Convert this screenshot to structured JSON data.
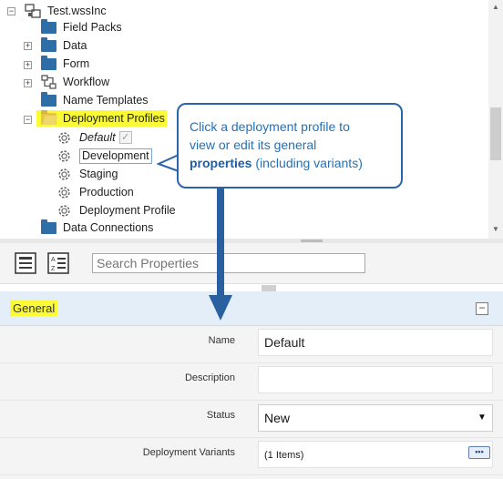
{
  "tree": {
    "root_label": "Test.wssInc",
    "items": [
      {
        "label": "Field Packs",
        "expander": ""
      },
      {
        "label": "Data",
        "expander": "+"
      },
      {
        "label": "Form",
        "expander": "+"
      },
      {
        "label": "Workflow",
        "expander": "+"
      },
      {
        "label": "Name Templates",
        "expander": ""
      },
      {
        "label": "Deployment Profiles",
        "expander": "−"
      },
      {
        "label": "Data Connections",
        "expander": ""
      }
    ],
    "profiles": [
      {
        "label": "Default"
      },
      {
        "label": "Development"
      },
      {
        "label": "Staging"
      },
      {
        "label": "Production"
      },
      {
        "label": "Deployment Profile"
      }
    ],
    "default_check": "✓"
  },
  "callout": {
    "line1": "Click a deployment profile to",
    "line2": "view or edit its general",
    "bold": "properties",
    "line3_rest": " (including variants)"
  },
  "toolbar": {
    "search_placeholder": "Search Properties"
  },
  "properties": {
    "section_title": "General",
    "collapse_symbol": "−",
    "name_label": "Name",
    "name_value": "Default",
    "description_label": "Description",
    "description_value": "",
    "status_label": "Status",
    "status_value": "New",
    "variants_label": "Deployment Variants",
    "variants_value": "(1 Items)",
    "variants_button": "•••"
  },
  "colors": {
    "highlight": "#fafa37",
    "folder": "#2e6ea6",
    "callout_border": "#2b65a8",
    "callout_text": "#2471b8",
    "section_header": "#e4eef8"
  }
}
